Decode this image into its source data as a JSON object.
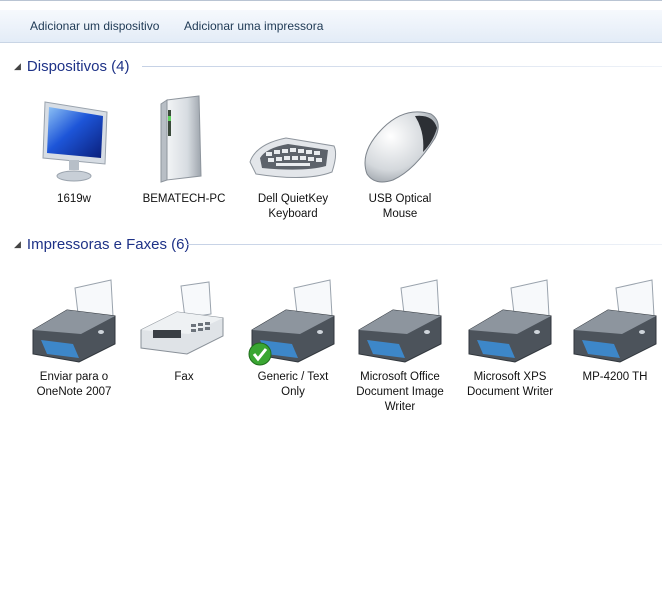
{
  "toolbar": {
    "add_device_label": "Adicionar um dispositivo",
    "add_printer_label": "Adicionar uma impressora"
  },
  "groups": {
    "devices": {
      "title": "Dispositivos (4)",
      "items": [
        {
          "label": "1619w",
          "icon": "monitor-icon"
        },
        {
          "label": "BEMATECH-PC",
          "icon": "computer-tower-icon"
        },
        {
          "label": "Dell QuietKey Keyboard",
          "icon": "keyboard-icon"
        },
        {
          "label": "USB Optical Mouse",
          "icon": "mouse-icon"
        }
      ]
    },
    "printers": {
      "title": "Impressoras e Faxes (6)",
      "items": [
        {
          "label": "Enviar para o OneNote 2007",
          "icon": "printer-icon"
        },
        {
          "label": "Fax",
          "icon": "fax-icon"
        },
        {
          "label": "Generic / Text Only",
          "icon": "printer-icon",
          "default_badge": "checkmark-icon"
        },
        {
          "label": "Microsoft Office Document Image Writer",
          "icon": "printer-icon"
        },
        {
          "label": "Microsoft XPS Document Writer",
          "icon": "printer-icon"
        },
        {
          "label": "MP-4200 TH",
          "icon": "printer-icon"
        }
      ]
    }
  },
  "colors": {
    "group_title": "#1e3287",
    "toolbar_text": "#1e3954",
    "default_check": "#3aa632"
  }
}
